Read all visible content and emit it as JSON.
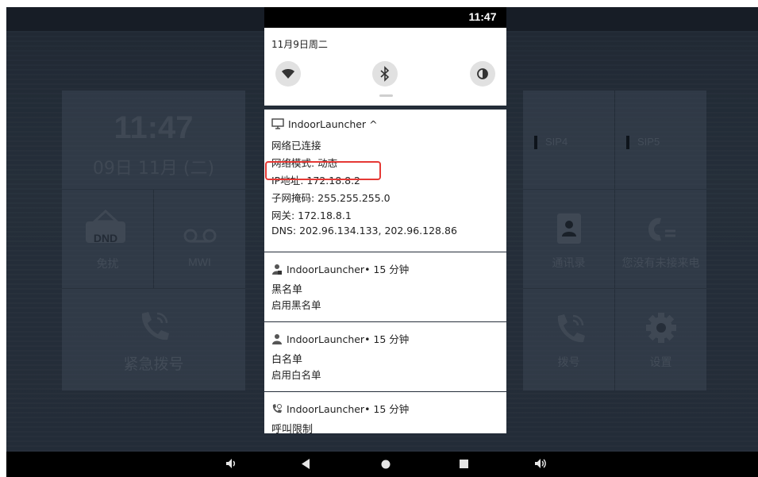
{
  "status_bar": {
    "time": "11:47"
  },
  "quick_settings": {
    "date": "11月9日周二",
    "tiles": [
      {
        "name": "wifi",
        "icon": "wifi-icon"
      },
      {
        "name": "bluetooth",
        "icon": "bluetooth-icon"
      },
      {
        "name": "invert-colors",
        "icon": "invert-colors-icon"
      }
    ]
  },
  "notifications": [
    {
      "app": "IndoorLauncher",
      "suffix": "^",
      "icon": "monitor-icon",
      "lines": [
        "网络已连接",
        "网络模式: 动态",
        "IP地址: 172.18.8.2",
        "子网掩码: 255.255.255.0",
        "网关: 172.18.8.1",
        "DNS: 202.96.134.133, 202.96.128.86"
      ]
    },
    {
      "app": "IndoorLauncher",
      "time": "• 15 分钟",
      "icon": "blacklist-person-icon",
      "title": "黑名单",
      "text": "启用黑名单"
    },
    {
      "app": "IndoorLauncher",
      "time": "• 15 分钟",
      "icon": "person-icon",
      "title": "白名单",
      "text": "启用白名单"
    },
    {
      "app": "IndoorLauncher",
      "time": "• 15 分钟",
      "icon": "phone-restrict-icon",
      "title": "呼叫限制"
    }
  ],
  "launcher": {
    "clock_time": "11:47",
    "clock_date": "09日 11月 (二)",
    "dnd_badge": "DND",
    "dnd_label": "免扰",
    "mwi_label": "MWI",
    "emergency_label": "紧急拨号",
    "sip4": "SIP4",
    "sip5": "SIP5",
    "contacts_label": "通讯录",
    "missed_label": "您没有未接来电",
    "dial_label": "拨号",
    "settings_label": "设置"
  },
  "nav_bar": [
    "volume-down-icon",
    "back-icon",
    "home-icon",
    "recents-icon",
    "volume-up-icon"
  ],
  "colors": {
    "highlight": "#e53935",
    "panel": "#ffffff",
    "navbar": "#000000"
  }
}
